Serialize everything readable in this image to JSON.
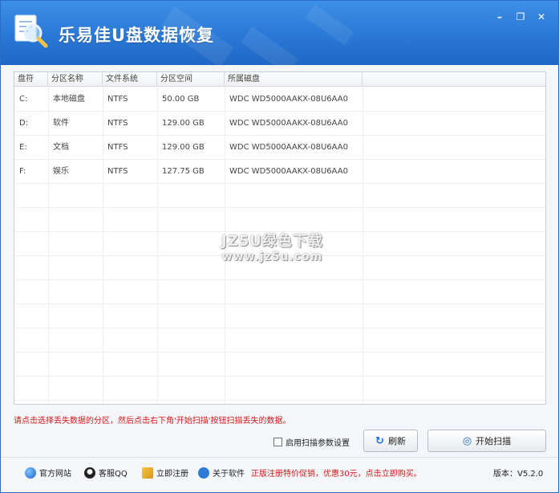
{
  "window": {
    "title": "乐易佳U盘数据恢复",
    "controls": {
      "minimize": "–",
      "restore": "❐",
      "close": "✕"
    }
  },
  "table": {
    "columns": [
      "盘符",
      "分区名称",
      "文件系统",
      "分区空间",
      "所属磁盘"
    ],
    "rows": [
      {
        "drive": "C:",
        "name": "本地磁盘",
        "fs": "NTFS",
        "size": "50.00 GB",
        "disk": "WDC WD5000AAKX-08U6AA0"
      },
      {
        "drive": "D:",
        "name": "软件",
        "fs": "NTFS",
        "size": "129.00 GB",
        "disk": "WDC WD5000AAKX-08U6AA0"
      },
      {
        "drive": "E:",
        "name": "文档",
        "fs": "NTFS",
        "size": "129.00 GB",
        "disk": "WDC WD5000AAKX-08U6AA0"
      },
      {
        "drive": "F:",
        "name": "娱乐",
        "fs": "NTFS",
        "size": "127.75 GB",
        "disk": "WDC WD5000AAKX-08U6AA0"
      }
    ]
  },
  "watermark": {
    "line1": "JZ5U绿色下载",
    "line2": "www.jz5u.com"
  },
  "hint": "请点击选择丢失数据的分区，然后点击右下角'开始扫描'按钮扫描丢失的数据。",
  "actions": {
    "scan_settings_label": "启用扫描参数设置",
    "refresh_label": "刷新",
    "start_scan_label": "开始扫描"
  },
  "footer": {
    "website": "官方网站",
    "support_qq": "客服QQ",
    "register": "立即注册",
    "about": "关于软件",
    "promo": "正版注册特价促销，优惠30元，点击立即购买。",
    "version_label": "版本：",
    "version": "V5.2.0"
  },
  "colors": {
    "title_bar": "#2a78d6",
    "hint_text": "#d31a1a",
    "accent": "#1d6fd1"
  }
}
